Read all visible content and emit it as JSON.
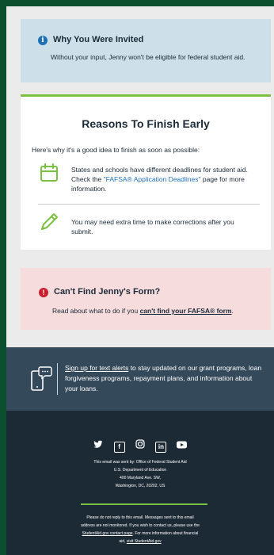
{
  "invited": {
    "title": "Why You Were Invited",
    "text": "Without your input, Jenny won't be eligible for federal student aid."
  },
  "reasons": {
    "title": "Reasons To Finish Early",
    "intro": "Here's why it's a good idea to finish as soon as possible:",
    "item1_before": "States and schools have different deadlines for student aid. Check the ",
    "item1_link": "\"FAFSA® Application Deadlines\"",
    "item1_after": " page for more information.",
    "item2": "You may need extra time to make corrections after you submit."
  },
  "cant_find": {
    "title": "Can't Find Jenny's Form?",
    "text_before": "Read about what to do if you ",
    "link": "can't find your FAFSA® form",
    "text_after": "."
  },
  "alerts": {
    "link": "Sign up for text alerts",
    "text": " to stay updated on our grant programs, loan forgiveness programs, repayment plans, and information about your loans."
  },
  "footer": {
    "social_icons": [
      "twitter-icon",
      "facebook-icon",
      "instagram-icon",
      "linkedin-icon",
      "youtube-icon"
    ],
    "address_lines": [
      "This email was sent by: Office of Federal Student Aid",
      "U.S. Department of Education",
      "400 Maryland Ave. SW,",
      "Washington, DC, 20202, US"
    ],
    "disclaimer_1": "Please do not reply to this email. Messages sent to this email",
    "disclaimer_2": "address are not monitored. If you wish to contact us, please use the",
    "disclaimer_link": "StudentAid.gov contact page",
    "disclaimer_3": ". For more information about financial",
    "disclaimer_4": "aid, ",
    "disclaimer_visit": "visit StudentAid.gov"
  },
  "colors": {
    "accent_green": "#7ac142",
    "info_blue": "#1f6fb5",
    "alert_red": "#cc1f2d",
    "footer_dark": "#1c2a36",
    "alerts_slate": "#34495a"
  }
}
